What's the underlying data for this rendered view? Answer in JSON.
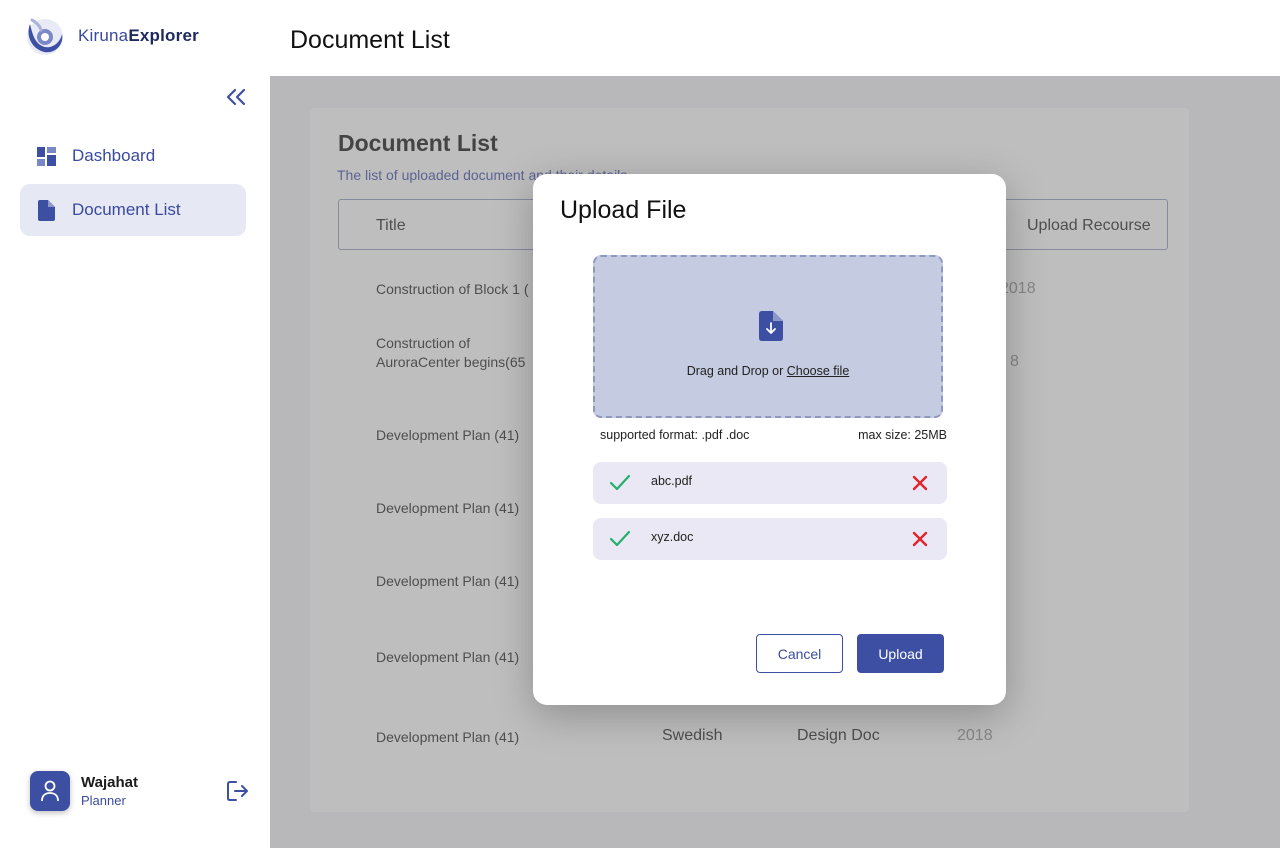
{
  "app": {
    "logo_light": "Kiruna",
    "logo_bold": "Explorer",
    "brand_color": "#3d4fa3"
  },
  "sidebar": {
    "items": [
      {
        "label": "Dashboard",
        "icon": "dashboard-icon",
        "active": false
      },
      {
        "label": "Document List",
        "icon": "document-icon",
        "active": true
      }
    ],
    "user": {
      "name": "Wajahat",
      "role": "Planner"
    }
  },
  "header": {
    "title": "Document List"
  },
  "main": {
    "title": "Document List",
    "subtitle": "The list of uploaded document and their details",
    "columns": [
      "Title",
      "Upload Recourse"
    ],
    "rows": [
      {
        "title": "Construction of Block 1 (",
        "language": "",
        "type": "",
        "year": "2018"
      },
      {
        "title": "Construction of AuroraCenter begins(65",
        "language": "",
        "type": "",
        "year": "8"
      },
      {
        "title": "Development Plan (41)",
        "language": "",
        "type": "",
        "year": ""
      },
      {
        "title": "Development Plan (41)",
        "language": "",
        "type": "",
        "year": ""
      },
      {
        "title": "Development Plan (41)",
        "language": "",
        "type": "",
        "year": ""
      },
      {
        "title": "Development Plan (41)",
        "language": "",
        "type": "",
        "year": ""
      },
      {
        "title": "Development Plan (41)",
        "language": "Swedish",
        "type": "Design Doc",
        "year": "2018"
      }
    ]
  },
  "modal": {
    "title": "Upload File",
    "drop_text": "Drag and Drop or ",
    "drop_link": "Choose file",
    "formats": "supported format: .pdf .doc",
    "max_size": "max size: 25MB",
    "files": [
      {
        "name": "abc.pdf"
      },
      {
        "name": "xyz.doc"
      }
    ],
    "cancel_label": "Cancel",
    "upload_label": "Upload"
  }
}
